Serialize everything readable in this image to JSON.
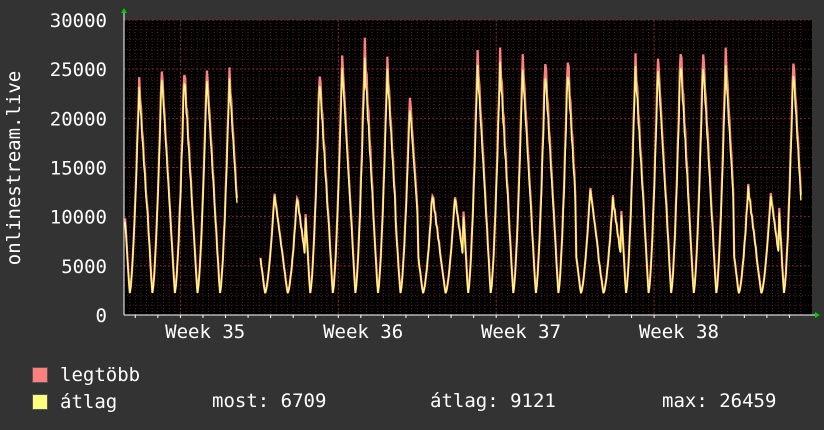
{
  "chart_data": {
    "type": "line",
    "ylabel": "onlinestream.live",
    "ylim": [
      0,
      30000
    ],
    "yticks": [
      "0",
      "5000",
      "10000",
      "15000",
      "20000",
      "25000",
      "30000"
    ],
    "xticks": [
      "Week 35",
      "Week 36",
      "Week 37",
      "Week 38"
    ],
    "grid": true,
    "series": [
      {
        "name": "legtöbb",
        "color": "#ff7f7f",
        "daily_peaks": [
          24000,
          25300,
          25300,
          25300,
          24900,
          null,
          12400,
          12200,
          25000,
          26500,
          27700,
          26000,
          22500,
          12500,
          12200,
          26700,
          26700,
          26600,
          26300,
          26500,
          13000,
          12000,
          26300,
          26500,
          27500,
          27100,
          27000,
          13100,
          12400,
          26300
        ]
      },
      {
        "name": "átlag",
        "color": "#ffff80",
        "daily_peaks": [
          23000,
          24400,
          24400,
          24200,
          23800,
          null,
          12200,
          12000,
          24000,
          25200,
          25700,
          24800,
          21200,
          12300,
          12000,
          25200,
          25300,
          25000,
          24800,
          25000,
          12800,
          11800,
          25000,
          25200,
          26000,
          25600,
          25200,
          12900,
          12100,
          25000
        ]
      }
    ],
    "daily_min": 2200,
    "gap_day": 5,
    "start_value": 10500,
    "end_value": 6709
  },
  "legend": [
    {
      "label": "legtöbb",
      "color": "#ff7f7f"
    },
    {
      "label": "átlag",
      "color": "#ffff80"
    }
  ],
  "stats": {
    "most": "most: 6709",
    "atlag": "átlag: 9121",
    "max": "max: 26459"
  }
}
